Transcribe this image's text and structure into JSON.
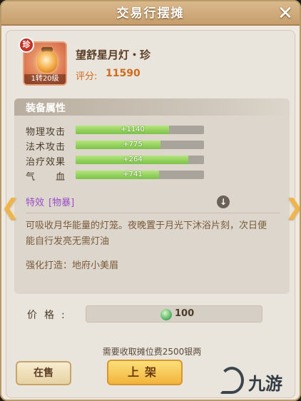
{
  "window": {
    "title": "交易行摆摊"
  },
  "item": {
    "rarity_badge": "珍",
    "level_label": "1转20级",
    "icon_name": "lantern-icon",
    "name": "望舒星月灯・珍",
    "score_label": "评分:",
    "score_value": "11590"
  },
  "attributes": {
    "header": "装备属性",
    "stats": [
      {
        "label": "物理攻击",
        "value": "+1140",
        "fill": 0.73
      },
      {
        "label": "法术攻击",
        "value": "+775",
        "fill": 0.66
      },
      {
        "label": "治疗效果",
        "value": "+264",
        "fill": 0.88
      },
      {
        "label": "气　　血",
        "value": "+741",
        "fill": 0.65
      }
    ],
    "effect_label": "特效",
    "effect_tag": "[物暴]",
    "description": "可吸收月华能量的灯笼。夜晚置于月光下沐浴片刻，次日便能自行发亮无需灯油",
    "forge_text": "强化打造：地府小美眉"
  },
  "price": {
    "label": "价格:",
    "value": "100",
    "currency_icon": "jade-coin-icon"
  },
  "fee_text": "需要收取摊位费2500银两",
  "buttons": {
    "on_sale": "在售",
    "list": "上架"
  },
  "watermark": {
    "text": "九游"
  },
  "colors": {
    "accent": "#f2b43b",
    "score": "#d06a1c",
    "effect": "#9b4cc8",
    "bar": "#7cc24a"
  }
}
